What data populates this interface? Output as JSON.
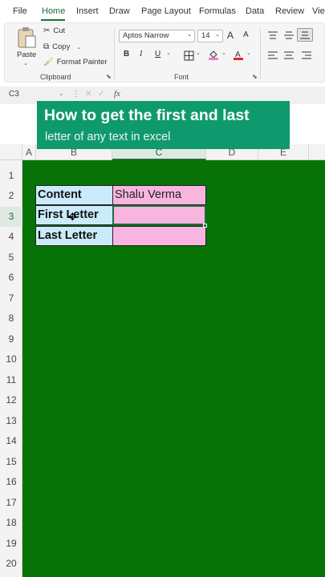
{
  "menu": {
    "tabs": [
      {
        "label": "File"
      },
      {
        "label": "Home"
      },
      {
        "label": "Insert"
      },
      {
        "label": "Draw"
      },
      {
        "label": "Page Layout"
      },
      {
        "label": "Formulas"
      },
      {
        "label": "Data"
      },
      {
        "label": "Review"
      },
      {
        "label": "View"
      }
    ],
    "active": "Home"
  },
  "ribbon": {
    "clipboard": {
      "paste": "Paste",
      "cut": "Cut",
      "copy": "Copy",
      "format_painter": "Format Painter",
      "group_label": "Clipboard"
    },
    "font": {
      "font_name": "Aptos Narrow",
      "font_size": "14",
      "bold": "B",
      "italic": "I",
      "underline": "U",
      "grow": "A",
      "shrink": "A",
      "group_label": "Font"
    }
  },
  "formula_bar": {
    "name_box": "C3",
    "fx": "fx",
    "value": ""
  },
  "banner": {
    "title": "How to get the first and last",
    "subtitle": "letter of any text in excel"
  },
  "sheet": {
    "columns": [
      "A",
      "B",
      "C",
      "D",
      "E"
    ],
    "selected_column": "C",
    "rows": [
      "1",
      "2",
      "3",
      "4",
      "5",
      "6",
      "7",
      "8",
      "9",
      "10",
      "11",
      "12",
      "13",
      "14",
      "15",
      "16",
      "17",
      "18",
      "19",
      "20"
    ],
    "selected_row": "3",
    "table": [
      {
        "label": "Content",
        "value": "Shalu Verma"
      },
      {
        "label": "First Letter",
        "value": ""
      },
      {
        "label": "Last Letter",
        "value": ""
      }
    ]
  },
  "colors": {
    "accent": "#1f6b3a",
    "banner": "#0f9a6e",
    "sheet_bg": "#077307",
    "label_fill": "#c9ebfa",
    "value_fill": "#f7b5df"
  }
}
